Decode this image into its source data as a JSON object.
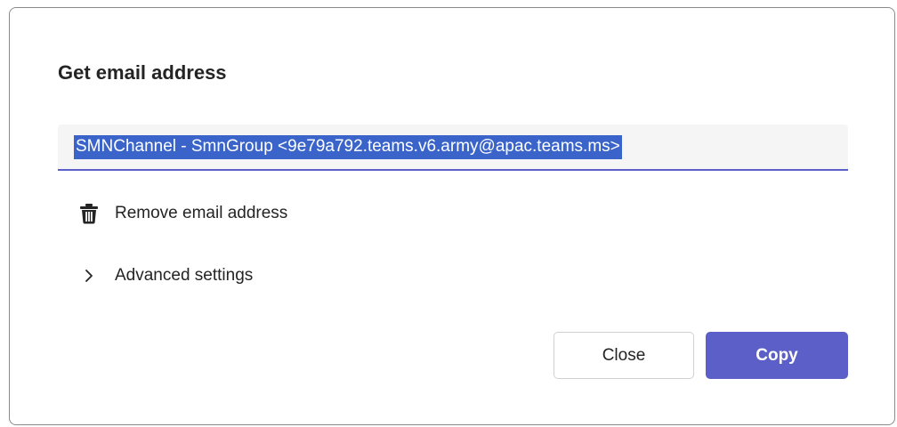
{
  "dialog": {
    "title": "Get email address",
    "email_value": "SMNChannel - SmnGroup <9e79a792.teams.v6.army@apac.teams.ms>",
    "remove_label": "Remove email address",
    "advanced_label": "Advanced settings",
    "close_label": "Close",
    "copy_label": "Copy"
  },
  "icons": {
    "remove": "trash-icon",
    "advanced": "chevron-right-icon"
  },
  "colors": {
    "accent": "#5b5fc7",
    "selection": "#3a64c9",
    "field_background": "#f5f5f5"
  }
}
